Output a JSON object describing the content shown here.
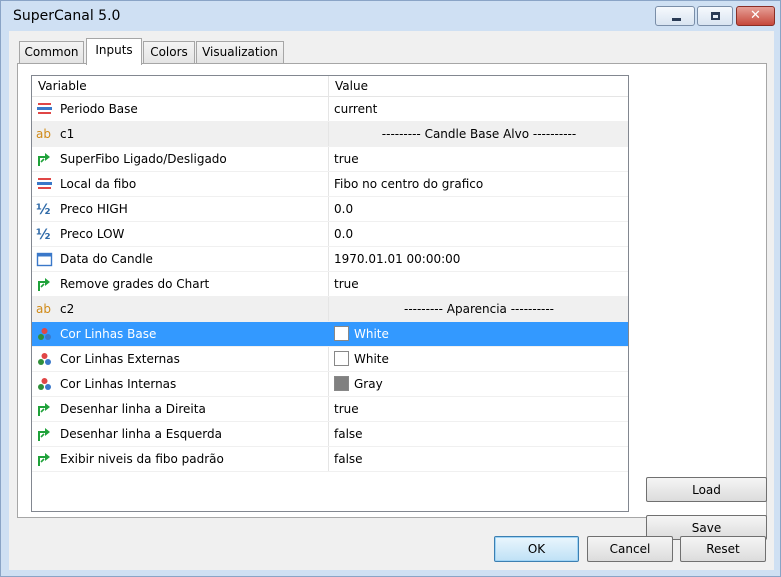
{
  "window": {
    "title": "SuperCanal 5.0",
    "close_glyph": "✕"
  },
  "tabs": [
    {
      "label": "Common"
    },
    {
      "label": "Inputs"
    },
    {
      "label": "Colors"
    },
    {
      "label": "Visualization"
    }
  ],
  "grid": {
    "headers": {
      "variable": "Variable",
      "value": "Value"
    },
    "rows": [
      {
        "icon": "enum-icon",
        "name": "Periodo Base",
        "value": "current"
      },
      {
        "icon": "string-icon",
        "name": "c1",
        "value": "--------- Candle Base Alvo ----------"
      },
      {
        "icon": "bool-icon",
        "name": "SuperFibo Ligado/Desligado",
        "value": "true"
      },
      {
        "icon": "enum-icon",
        "name": "Local da fibo",
        "value": "Fibo no centro do grafico"
      },
      {
        "icon": "double-icon",
        "name": "Preco HIGH",
        "value": "0.0"
      },
      {
        "icon": "double-icon",
        "name": "Preco LOW",
        "value": "0.0"
      },
      {
        "icon": "datetime-icon",
        "name": "Data do Candle",
        "value": "1970.01.01 00:00:00"
      },
      {
        "icon": "bool-icon",
        "name": "Remove grades do Chart",
        "value": "true"
      },
      {
        "icon": "string-icon",
        "name": "c2",
        "value": "--------- Aparencia ----------"
      },
      {
        "icon": "color-icon",
        "name": "Cor Linhas Base",
        "value": "White",
        "swatch": "#ffffff"
      },
      {
        "icon": "color-icon",
        "name": "Cor Linhas Externas",
        "value": "White",
        "swatch": "#ffffff"
      },
      {
        "icon": "color-icon",
        "name": "Cor Linhas Internas",
        "value": "Gray",
        "swatch": "#808080"
      },
      {
        "icon": "bool-icon",
        "name": "Desenhar linha a Direita",
        "value": "true"
      },
      {
        "icon": "bool-icon",
        "name": "Desenhar linha a Esquerda",
        "value": "false"
      },
      {
        "icon": "bool-icon",
        "name": "Exibir niveis da fibo padrão",
        "value": "false"
      }
    ]
  },
  "buttons": {
    "load": "Load",
    "save": "Save",
    "ok": "OK",
    "cancel": "Cancel",
    "reset": "Reset"
  },
  "colors": {
    "selection": "#3399ff",
    "separator_row": "#f0f0f0"
  }
}
